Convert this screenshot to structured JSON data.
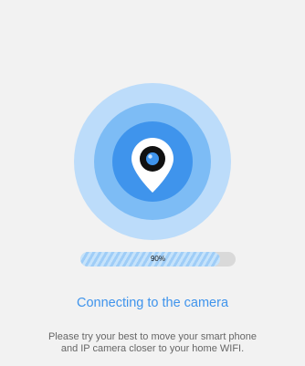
{
  "icons": {
    "center": "location-pin-icon"
  },
  "colors": {
    "background": "#f2f2f2",
    "ring_outer": "#bcdcfa",
    "ring_mid": "#7dbcf5",
    "ring_inner": "#3f94ec",
    "accent": "#3f94ec",
    "progress_track": "#d9d9d9"
  },
  "progress": {
    "value": 0.9,
    "label": "90%"
  },
  "status": {
    "title": "Connecting to the camera",
    "message_line1": "Please try your best to move your smart phone",
    "message_line2": "and IP camera closer to your home WIFI."
  }
}
